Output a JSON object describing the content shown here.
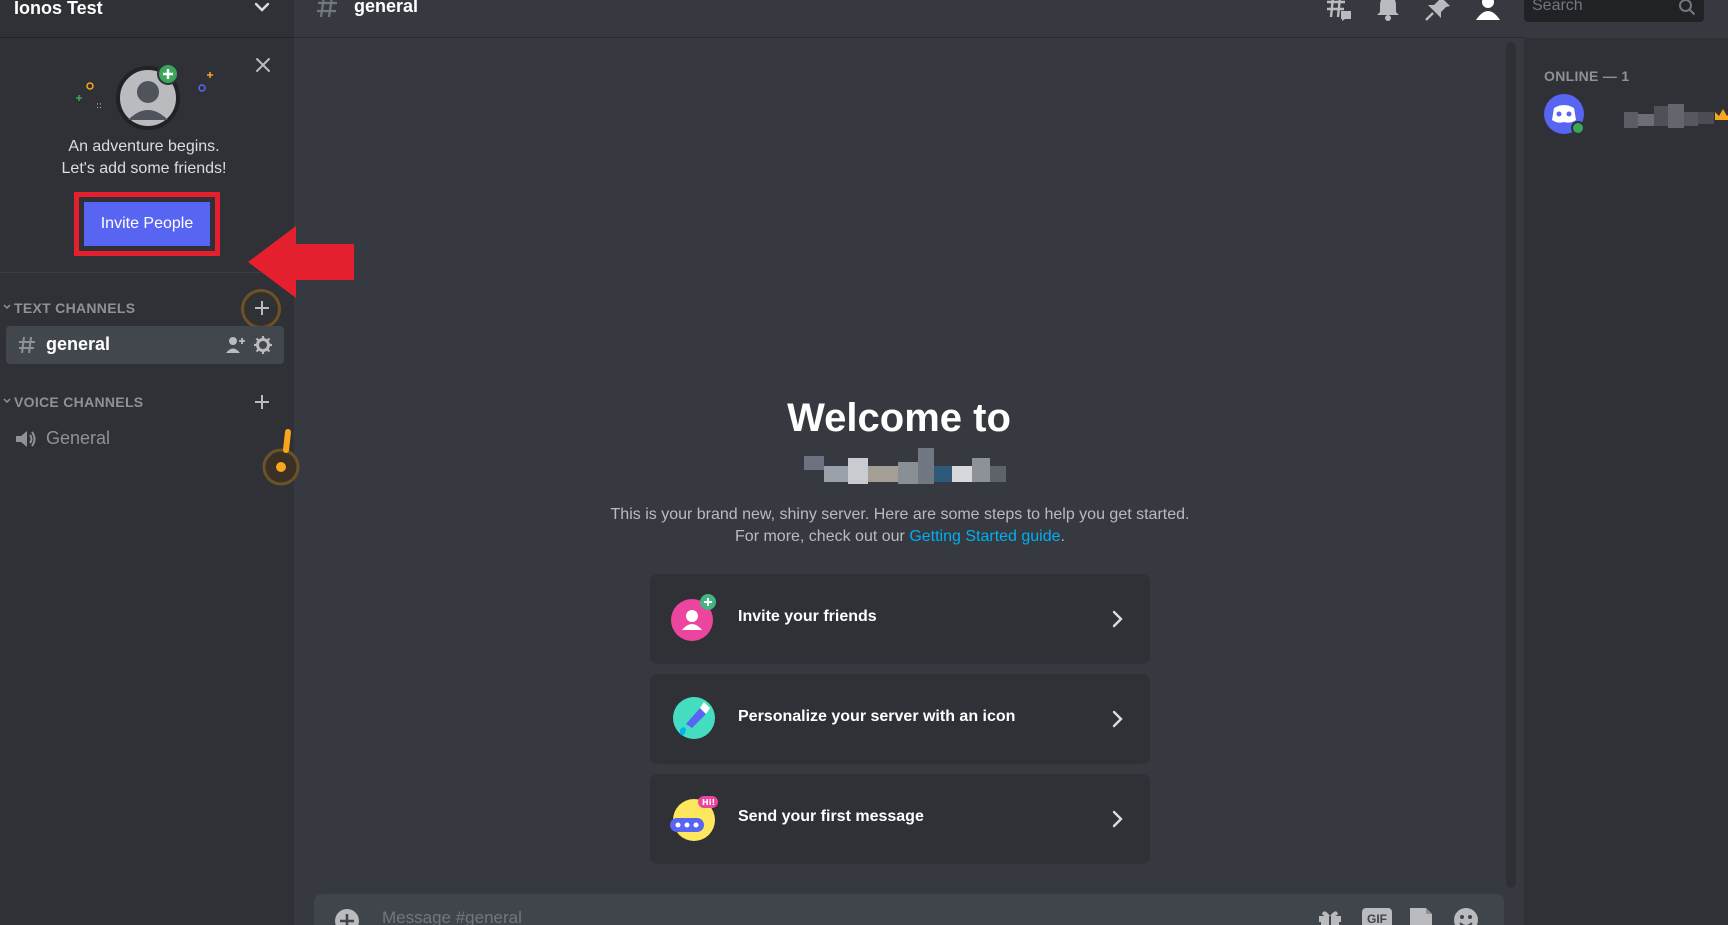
{
  "server": {
    "name": "Ionos Test"
  },
  "invite_card": {
    "line1": "An adventure begins.",
    "line2": "Let's add some friends!",
    "button_label": "Invite People"
  },
  "sidebar": {
    "text_category": "TEXT CHANNELS",
    "voice_category": "VOICE CHANNELS",
    "text_channels": [
      {
        "name": "general"
      }
    ],
    "voice_channels": [
      {
        "name": "General"
      }
    ]
  },
  "header": {
    "channel_name": "general",
    "search_placeholder": "Search",
    "icons": [
      "threads-icon",
      "bell-icon",
      "pin-icon",
      "members-icon"
    ]
  },
  "welcome": {
    "title": "Welcome to",
    "desc_text": "This is your brand new, shiny server. Here are some steps to help you get started. For more, check out our ",
    "link_text": "Getting Started guide",
    "desc_end": ".",
    "steps": [
      {
        "label": "Invite your friends",
        "icon": "invite-friends-icon"
      },
      {
        "label": "Personalize your server with an icon",
        "icon": "brush-icon"
      },
      {
        "label": "Send your first message",
        "icon": "message-icon"
      }
    ]
  },
  "composer": {
    "placeholder": "Message #general",
    "gif_label": "GIF"
  },
  "members": {
    "heading": "ONLINE — 1"
  },
  "colors": {
    "accent": "#5865f2",
    "highlight_red": "#e5202e",
    "link": "#00aff4",
    "online": "#3ba55c",
    "crown": "#faa61a"
  }
}
